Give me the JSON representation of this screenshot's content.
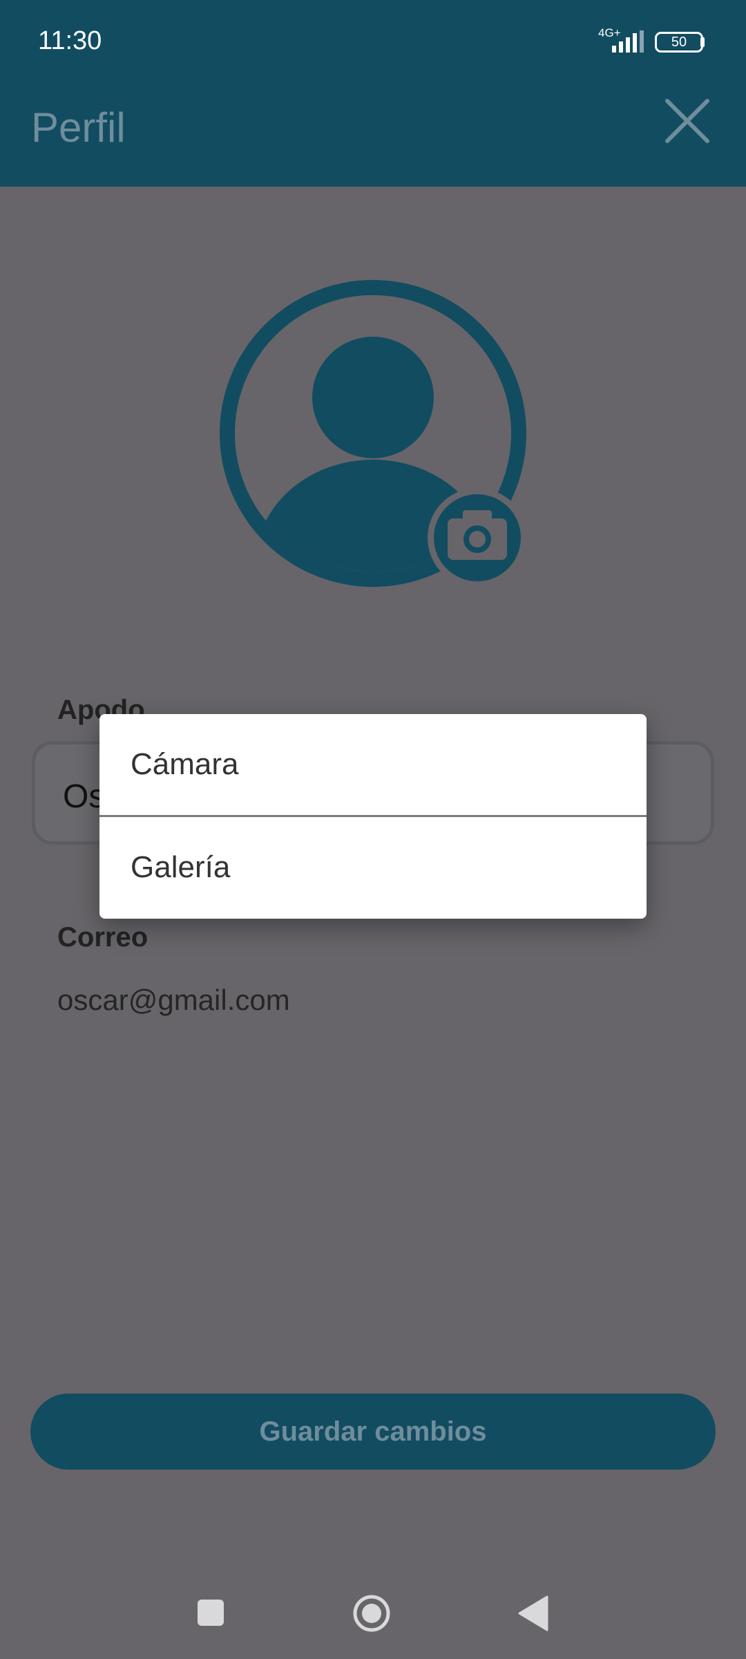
{
  "status_bar": {
    "time": "11:30",
    "network": "4G+",
    "battery": "50"
  },
  "header": {
    "title": "Perfil",
    "close_icon": "close-icon"
  },
  "avatar": {
    "icon": "user-avatar-icon",
    "camera_icon": "camera-icon"
  },
  "form": {
    "apodo_label": "Apodo",
    "apodo_value": "Os",
    "correo_label": "Correo",
    "correo_value": "oscar@gmail.com"
  },
  "save_button": "Guardar cambios",
  "dialog": {
    "options": [
      "Cámara",
      "Galería"
    ]
  },
  "colors": {
    "primary": "#1a7891",
    "primary_dimmed": "#124c61",
    "overlay": "#676569"
  }
}
